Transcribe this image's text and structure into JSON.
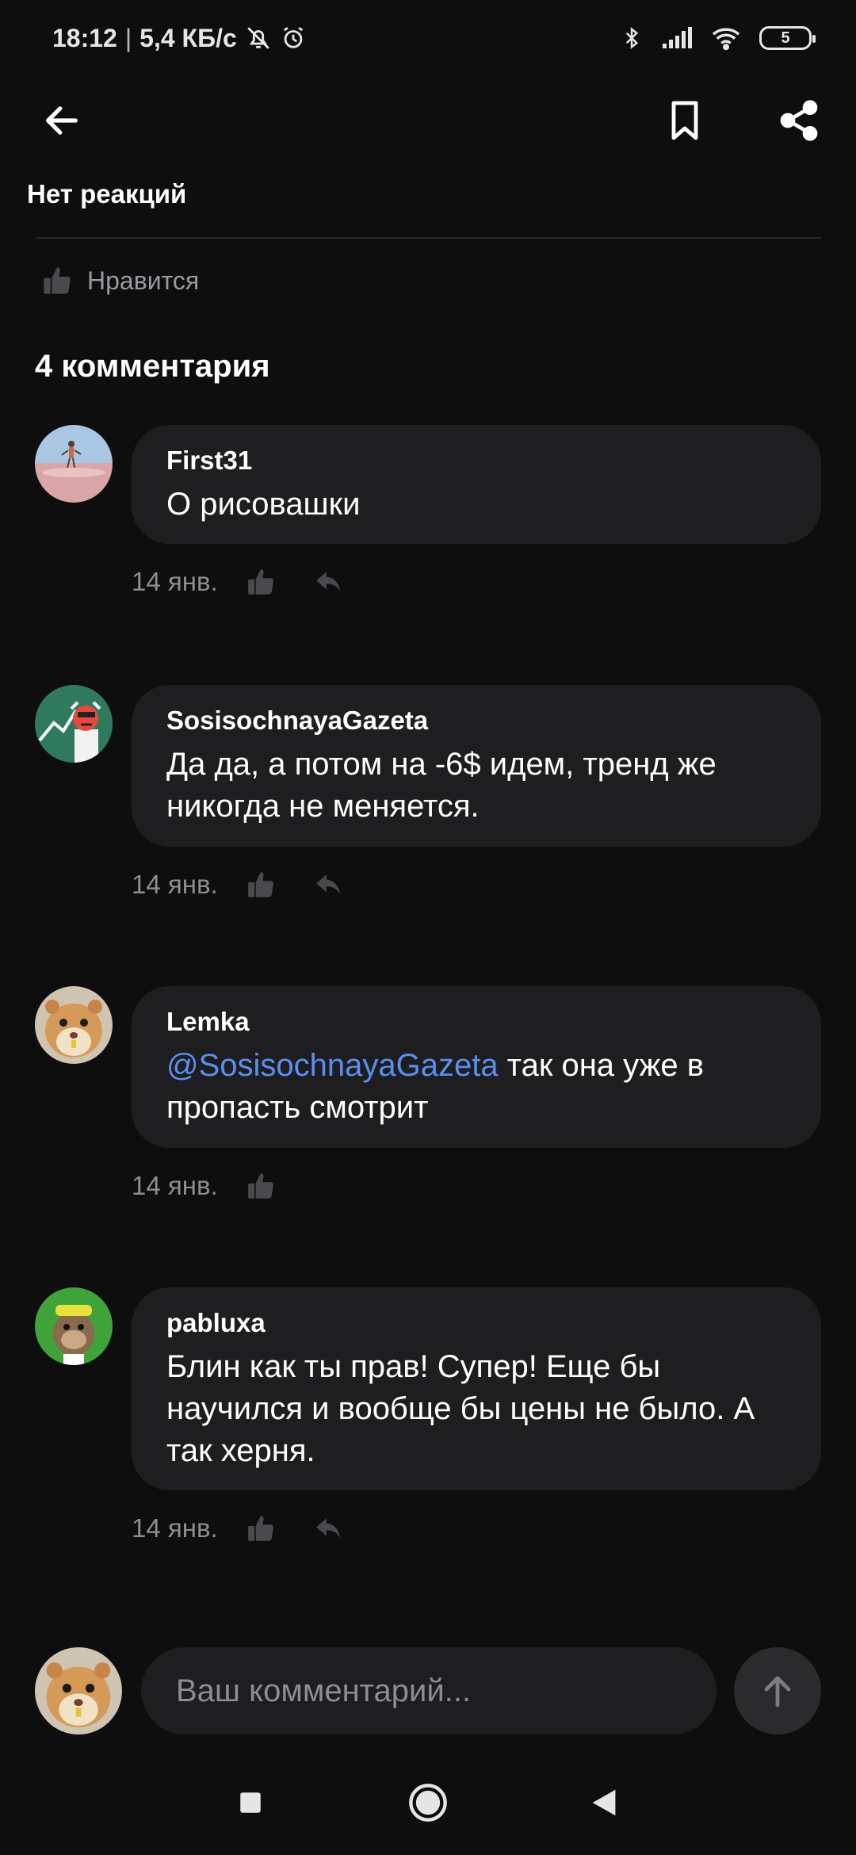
{
  "status_bar": {
    "time": "18:12",
    "separator": "|",
    "speed": "5,4 КБ/с",
    "battery": "5",
    "icons": [
      "mute-bell-icon",
      "alarm-icon",
      "bluetooth-icon",
      "signal-icon",
      "wifi-icon",
      "battery-icon"
    ]
  },
  "toolbar": {
    "back_icon": "arrow-left-icon",
    "bookmark_icon": "bookmark-icon",
    "share_icon": "share-icon"
  },
  "reactions": {
    "title": "Нет реакций",
    "like_label": "Нравится"
  },
  "comments_title": "4 комментария",
  "comments": [
    {
      "author": "First31",
      "text": "О рисовашки",
      "mention": "",
      "date": "14 янв.",
      "has_reply": true
    },
    {
      "author": "SosisochnayaGazeta",
      "text": "Да да, а потом на -6$ идем, тренд же никогда не меняется.",
      "mention": "",
      "date": "14 янв.",
      "has_reply": true
    },
    {
      "author": "Lemka",
      "mention": "@SosisochnayaGazeta",
      "text": " так она уже в пропасть смотрит",
      "date": "14 янв.",
      "has_reply": false
    },
    {
      "author": "pabluxa",
      "text": "Блин как ты прав! Супер! Еще бы научился и вообще бы цены не было. А так херня.",
      "mention": "",
      "date": "14 янв.",
      "has_reply": true
    }
  ],
  "input": {
    "placeholder": "Ваш комментарий...",
    "value": ""
  },
  "colors": {
    "background": "#0e0e0f",
    "bubble": "#1e1e20",
    "mention": "#5b8ef0",
    "muted_text": "#8d8d92"
  }
}
